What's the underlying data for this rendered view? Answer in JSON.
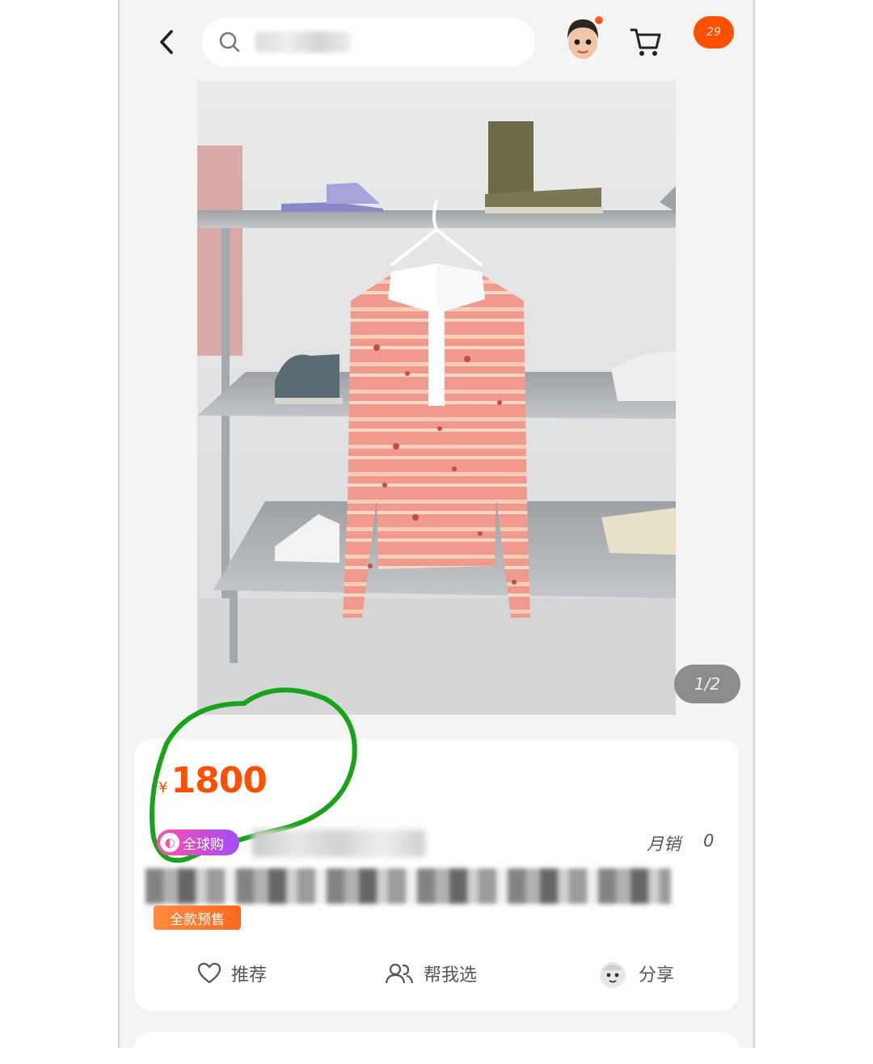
{
  "header": {
    "back_icon": "chevron-left-icon",
    "search_icon": "search-icon",
    "cart_icon": "cart-icon",
    "message_badge": "29"
  },
  "gallery": {
    "counter": "1/2"
  },
  "product": {
    "currency": "¥",
    "price": "1800",
    "global_tag": "全球购",
    "monthly_sales_label": "月销",
    "monthly_sales_value": "0",
    "presale_tag": "全款预售"
  },
  "actions": {
    "recommend": "推荐",
    "help_choose": "帮我选",
    "share": "分享"
  },
  "colors": {
    "accent": "#ff5000",
    "annotation": "#1aa31a"
  }
}
